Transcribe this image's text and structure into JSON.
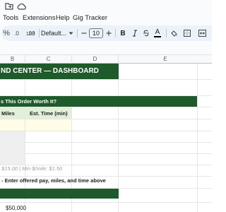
{
  "menu": {
    "tools": "Tools",
    "extensions": "Extensions",
    "help": "Help",
    "gig_tracker": "Gig Tracker"
  },
  "toolbar": {
    "percent_label": "%",
    "decimal_decrease": ".0",
    "decimal_increase": ".00",
    "number_format": "123",
    "font_name": "Default...",
    "font_size": "10",
    "bold": "B",
    "text_color_letter": "A"
  },
  "columns": [
    "B",
    "C",
    "D",
    "E"
  ],
  "sheet": {
    "dashboard_banner": "ND CENTER — DASHBOARD",
    "order_question": "s This Order Worth It?",
    "miles_header": "Miles",
    "time_header": "Est. Time (min)",
    "min_line": "$15.00 | Min $/mile: $1.50",
    "instruction": "- Enter offered pay, miles, and time above",
    "value": "$50,000"
  },
  "colors": {
    "banner_green": "#1e5a2a",
    "input_yellow": "#fffde7",
    "header_green": "#e2efd9",
    "gray_cells": "#efefef"
  }
}
